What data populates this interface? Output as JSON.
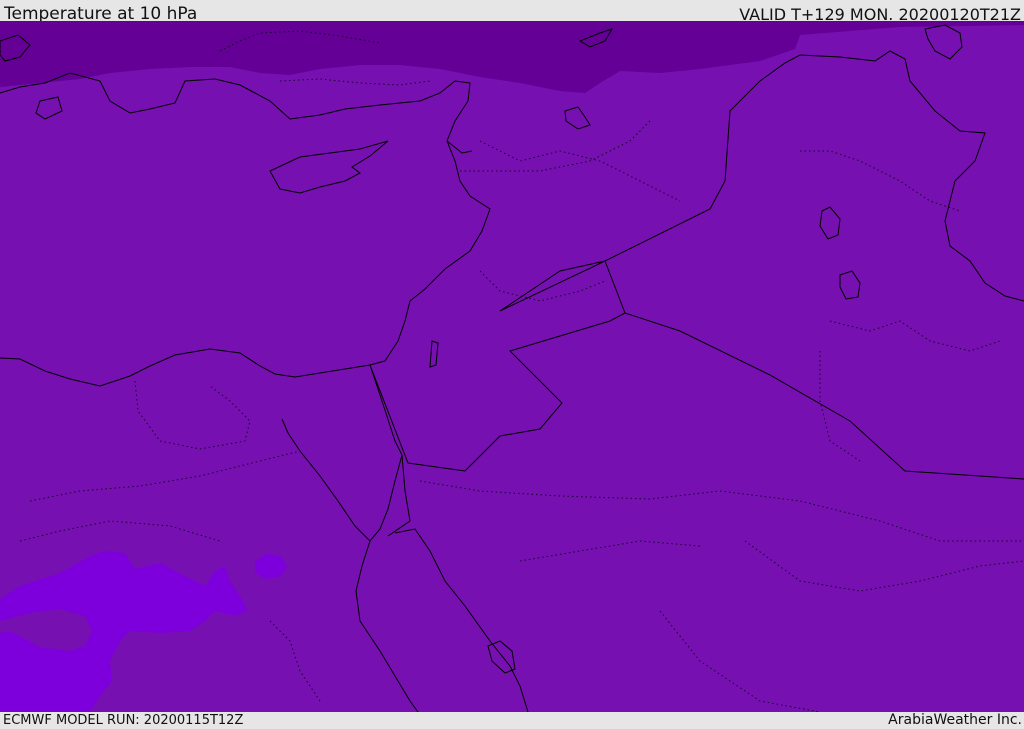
{
  "header": {
    "title": "Temperature at 10 hPa",
    "valid": "VALID T+129 MON. 20200120T21Z"
  },
  "footer": {
    "model_run": "ECMWF MODEL RUN: 20200115T12Z",
    "credit": "ArabiaWeather Inc."
  },
  "map": {
    "colors": {
      "base_field": "#7710b0",
      "cold_band": "#640096",
      "warm_patch": "#7d00dc",
      "coastline": "#000000"
    }
  }
}
